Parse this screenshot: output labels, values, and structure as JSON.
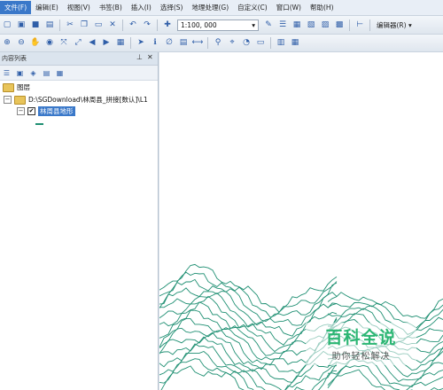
{
  "menu": [
    "文件(F)",
    "编辑(E)",
    "视图(V)",
    "书签(B)",
    "插入(I)",
    "选择(S)",
    "地理处理(G)",
    "自定义(C)",
    "窗口(W)",
    "帮助(H)"
  ],
  "toolbar": {
    "scale": "1:100, 000",
    "editor_label": "编辑器(R) ▾"
  },
  "toc": {
    "title": "内容列表",
    "root_label": "图层",
    "path_label": "D:\\SGDownload\\林周县_拼接[数认]\\L1",
    "layer_label": "林周县地形",
    "layer_checked": "✔"
  },
  "map": {
    "contour_color": "#1e8f72"
  },
  "watermark": {
    "title": "百科全说",
    "subtitle": "助你轻松解决"
  }
}
